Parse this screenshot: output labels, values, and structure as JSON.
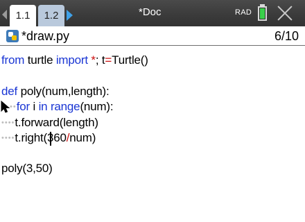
{
  "tabs": [
    {
      "label": "1.1"
    },
    {
      "label": "1.2"
    }
  ],
  "title_bar": {
    "document_title": "*Doc",
    "angle_mode": "RAD"
  },
  "header": {
    "file_name": "*draw.py",
    "line_counter": "6/10"
  },
  "code": {
    "line1": {
      "kw1": "from",
      "t1": " turtle ",
      "kw2": "import",
      "t2": " ",
      "op1": "*",
      "t3": "; t",
      "op2": "=",
      "t4": "Turtle()"
    },
    "line3": {
      "kw1": "def",
      "t1": " poly(num,length):"
    },
    "line4": {
      "dots": "••",
      "kw1": "for",
      "t1": " i ",
      "kw2": "in",
      "t2": " ",
      "kw3": "range",
      "t3": "(num):"
    },
    "line5": {
      "dots": "••••",
      "t1": "t.forward(length)"
    },
    "line6": {
      "dots": "••••",
      "t1": "t.right(360",
      "op1": "/",
      "t2": "num)"
    },
    "line8": {
      "t1": "poly(3,50)"
    }
  },
  "colors": {
    "keyword": "#1a36d4",
    "operator": "#cc1010",
    "active_arrow": "#3fa1e8",
    "battery": "#39d04a"
  },
  "icons": [
    "arrow-left-icon",
    "arrow-right-icon",
    "battery-icon",
    "close-icon",
    "python-file-icon",
    "mouse-pointer-icon"
  ]
}
